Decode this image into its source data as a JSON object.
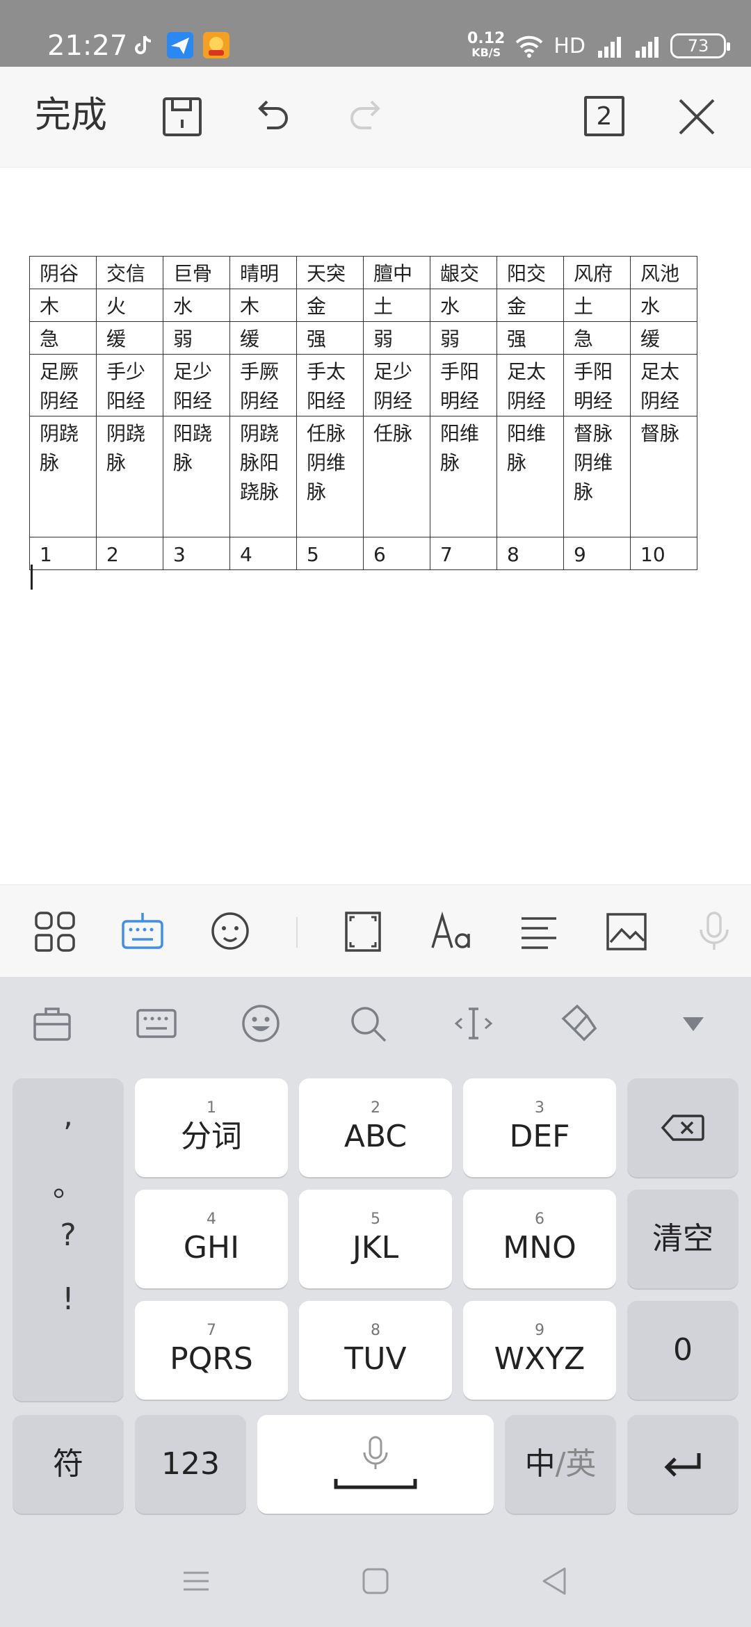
{
  "status_bar": {
    "time": "21:27",
    "net_speed_value": "0.12",
    "net_speed_unit": "KB/S",
    "hd_label": "HD",
    "battery": "73"
  },
  "top_toolbar": {
    "done_label": "完成",
    "page_count": "2"
  },
  "table": {
    "rows": [
      [
        "阴谷",
        "交信",
        "巨骨",
        "晴明",
        "天突",
        "膻中",
        "龈交",
        "阳交",
        "风府",
        "风池"
      ],
      [
        "木",
        "火",
        "水",
        "木",
        "金",
        "土",
        "水",
        "金",
        "土",
        "水"
      ],
      [
        "急",
        "缓",
        "弱",
        "缓",
        "强",
        "弱",
        "弱",
        "强",
        "急",
        "缓"
      ],
      [
        "足厥阴经",
        "手少阳经",
        "足少阳经",
        "手厥阴经",
        "手太阳经",
        "足少阴经",
        "手阳明经",
        "足太阴经",
        "手阳明经",
        "足太阴经"
      ],
      [
        "阴跷脉",
        "阴跷脉",
        "阳跷脉",
        "阴跷脉阳跷脉",
        "任脉阴维脉",
        "任脉",
        "阳维脉",
        "阳维脉",
        "督脉阴维脉",
        "督脉"
      ],
      [
        "1",
        "2",
        "3",
        "4",
        "5",
        "6",
        "7",
        "8",
        "9",
        "10"
      ]
    ]
  },
  "keyboard": {
    "punctuation": [
      ",",
      "。",
      "?",
      "!"
    ],
    "keys": {
      "k1": {
        "num": "1",
        "label": "分词"
      },
      "k2": {
        "num": "2",
        "label": "ABC"
      },
      "k3": {
        "num": "3",
        "label": "DEF"
      },
      "k4": {
        "num": "4",
        "label": "GHI"
      },
      "k5": {
        "num": "5",
        "label": "JKL"
      },
      "k6": {
        "num": "6",
        "label": "MNO"
      },
      "k7": {
        "num": "7",
        "label": "PQRS"
      },
      "k8": {
        "num": "8",
        "label": "TUV"
      },
      "k9": {
        "num": "9",
        "label": "WXYZ"
      },
      "clear": "清空",
      "zero": "0",
      "symbols": "符",
      "numbers": "123",
      "lang_zh": "中",
      "lang_sep": "/",
      "lang_en": "英"
    }
  },
  "colors": {
    "accent": "#3d8ef0",
    "status_bar": "#8e8e8e",
    "keyboard_bg": "#e0e1e5"
  }
}
